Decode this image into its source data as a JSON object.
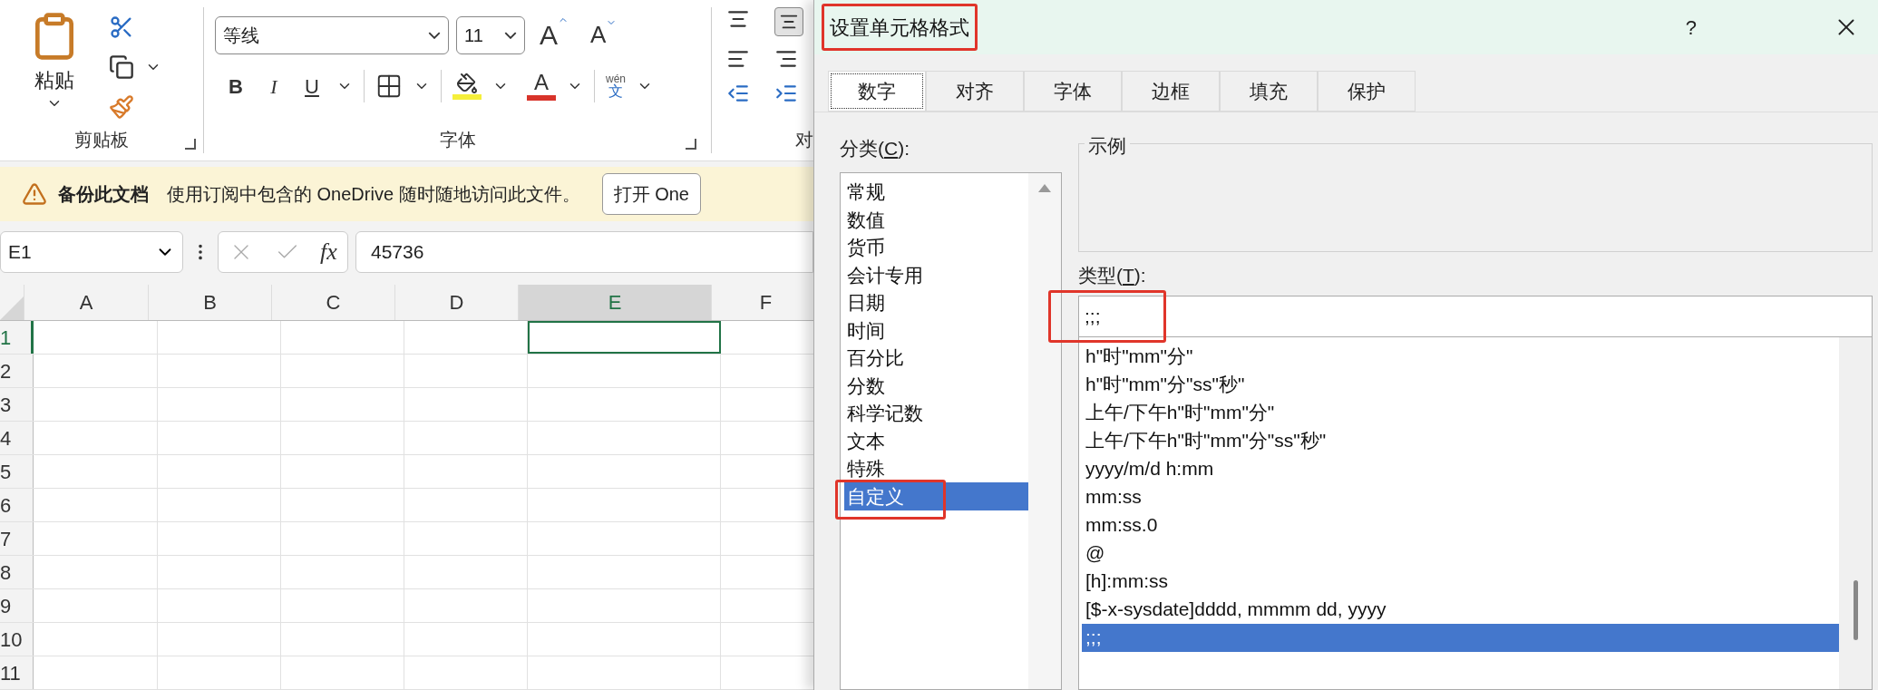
{
  "ribbon": {
    "clipboard": {
      "paste_label": "粘贴",
      "group_label": "剪贴板"
    },
    "font": {
      "font_name": "等线",
      "font_size": "11",
      "grow_label": "A",
      "shrink_label": "A",
      "bold_label": "B",
      "italic_label": "I",
      "underline_label": "U",
      "font_color_label": "A",
      "phonetic_top": "wén",
      "phonetic_bottom": "文",
      "group_label": "字体"
    },
    "alignment": {
      "group_label": "对"
    }
  },
  "notification": {
    "title": "备份此文档",
    "message": "使用订阅中包含的 OneDrive 随时随地访问此文件。",
    "button": "打开 One"
  },
  "formula_bar": {
    "name_box": "E1",
    "fx_label": "fx",
    "value": "45736"
  },
  "grid": {
    "columns": [
      {
        "label": "A",
        "selected": false
      },
      {
        "label": "B",
        "selected": false
      },
      {
        "label": "C",
        "selected": false
      },
      {
        "label": "D",
        "selected": false
      },
      {
        "label": "E",
        "selected": true
      },
      {
        "label": "F",
        "selected": false
      }
    ],
    "rows": [
      {
        "label": "1",
        "selected": true
      },
      {
        "label": "2",
        "selected": false
      },
      {
        "label": "3",
        "selected": false
      },
      {
        "label": "4",
        "selected": false
      },
      {
        "label": "5",
        "selected": false
      },
      {
        "label": "6",
        "selected": false
      },
      {
        "label": "7",
        "selected": false
      },
      {
        "label": "8",
        "selected": false
      },
      {
        "label": "9",
        "selected": false
      },
      {
        "label": "10",
        "selected": false
      },
      {
        "label": "11",
        "selected": false
      }
    ]
  },
  "dialog": {
    "title": "设置单元格格式",
    "help": "?",
    "tabs": [
      {
        "label": "数字",
        "selected": true
      },
      {
        "label": "对齐",
        "selected": false
      },
      {
        "label": "字体",
        "selected": false
      },
      {
        "label": "边框",
        "selected": false
      },
      {
        "label": "填充",
        "selected": false
      },
      {
        "label": "保护",
        "selected": false
      }
    ],
    "category_label": {
      "before": "分类(",
      "key": "C",
      "after": "):"
    },
    "categories": [
      {
        "label": "常规",
        "selected": false
      },
      {
        "label": "数值",
        "selected": false
      },
      {
        "label": "货币",
        "selected": false
      },
      {
        "label": "会计专用",
        "selected": false
      },
      {
        "label": "日期",
        "selected": false
      },
      {
        "label": "时间",
        "selected": false
      },
      {
        "label": "百分比",
        "selected": false
      },
      {
        "label": "分数",
        "selected": false
      },
      {
        "label": "科学记数",
        "selected": false
      },
      {
        "label": "文本",
        "selected": false
      },
      {
        "label": "特殊",
        "selected": false
      },
      {
        "label": "自定义",
        "selected": true
      }
    ],
    "sample_label": "示例",
    "type_label": {
      "before": "类型(",
      "key": "T",
      "after": "):"
    },
    "type_value": ";;;",
    "formats": [
      {
        "label": "h\"时\"mm\"分\"",
        "selected": false
      },
      {
        "label": "h\"时\"mm\"分\"ss\"秒\"",
        "selected": false
      },
      {
        "label": "上午/下午h\"时\"mm\"分\"",
        "selected": false
      },
      {
        "label": "上午/下午h\"时\"mm\"分\"ss\"秒\"",
        "selected": false
      },
      {
        "label": "yyyy/m/d h:mm",
        "selected": false
      },
      {
        "label": "mm:ss",
        "selected": false
      },
      {
        "label": "mm:ss.0",
        "selected": false
      },
      {
        "label": "@",
        "selected": false
      },
      {
        "label": "[h]:mm:ss",
        "selected": false
      },
      {
        "label": "[$-x-sysdate]dddd, mmmm dd, yyyy",
        "selected": false
      },
      {
        "label": ";;;",
        "selected": true
      }
    ]
  }
}
